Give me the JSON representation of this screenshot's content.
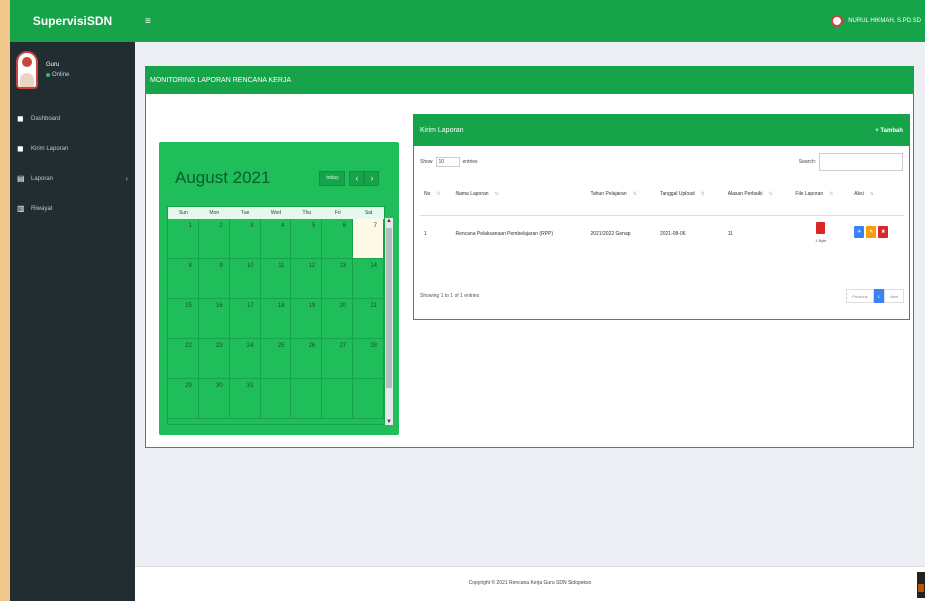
{
  "sidebar": {
    "logo": "SupervisiSDN",
    "user": {
      "name": "Guru",
      "status": "Online"
    },
    "items": [
      {
        "label": "Dashboard",
        "icon": "dashboard-icon"
      },
      {
        "label": "Kirim Laporan",
        "icon": "send-icon"
      },
      {
        "label": "Laporan",
        "icon": "report-icon",
        "has_submenu": true
      },
      {
        "label": "Riwayat",
        "icon": "history-icon"
      }
    ]
  },
  "header": {
    "menu_icon": "hamburger-icon",
    "user_name": "NURUL HIKMAH, S.PD.SD"
  },
  "page": {
    "title": "MONITORING LAPORAN RENCANA KERJA"
  },
  "calendar": {
    "month_label": "August 2021",
    "today_label": "today",
    "days_of_week": [
      "Sun",
      "Mon",
      "Tue",
      "Wed",
      "Thu",
      "Fri",
      "Sat"
    ],
    "weeks": [
      [
        "1",
        "2",
        "3",
        "4",
        "5",
        "6",
        "7"
      ],
      [
        "8",
        "9",
        "10",
        "11",
        "12",
        "13",
        "14"
      ],
      [
        "15",
        "16",
        "17",
        "18",
        "19",
        "20",
        "21"
      ],
      [
        "22",
        "23",
        "24",
        "25",
        "26",
        "27",
        "28"
      ],
      [
        "29",
        "30",
        "31",
        "",
        "",
        "",
        ""
      ]
    ]
  },
  "panel": {
    "title": "Kirim Laporan",
    "add_label": "+ Tambah",
    "show_label": "Show",
    "entries_value": "10",
    "entries_label": "entries",
    "search_label": "Search:",
    "columns": [
      "No",
      "Nama Laporan",
      "Tahun Pelajaran",
      "Tanggal Upload",
      "Alasan Perbaiki",
      "File Laporan",
      "Aksi"
    ],
    "rows": [
      {
        "no": "1",
        "nama": "Rencana Pelaksanaan Pembelajaran (RPP)",
        "tahun": "2021/2022 Genap",
        "tanggal": "2021-08-06",
        "alasan": "11",
        "file_size": "1 Byte"
      }
    ],
    "info": "Showing 1 to 1 of 1 entries",
    "pagination": {
      "previous": "Previous",
      "current": "1",
      "next": "Next"
    }
  },
  "footer": {
    "text": "Copyright © 2021 Rencana Kerja Guru SDN Sidopekso"
  },
  "colors": {
    "brand_green": "#16a34a",
    "sidebar_dark": "#222d32",
    "calendar_green": "#20bd5b"
  }
}
